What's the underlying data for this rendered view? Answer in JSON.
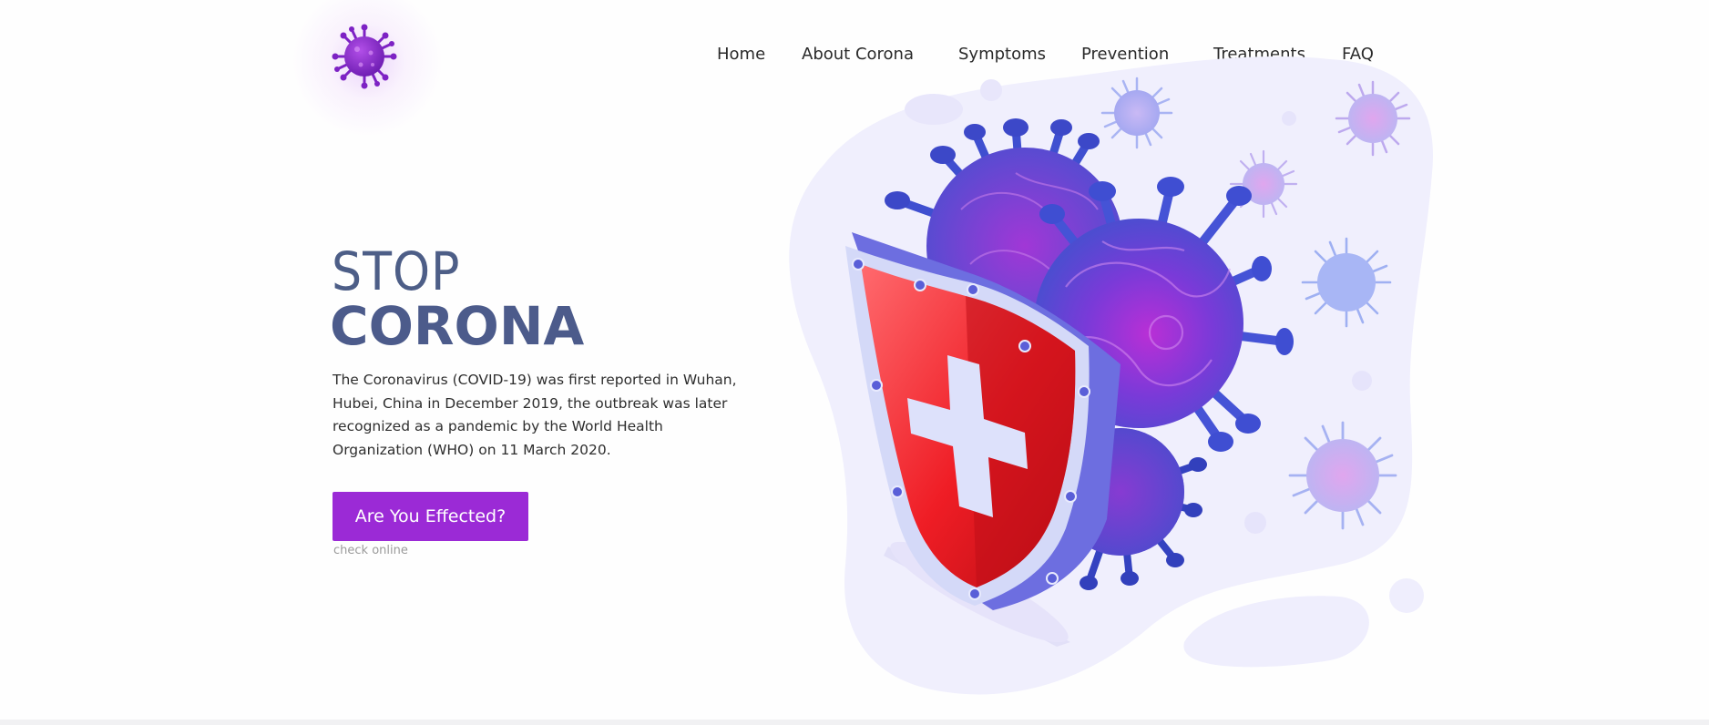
{
  "nav": {
    "items": [
      "Home",
      "About Corona",
      "Symptoms",
      "Prevention",
      "Treatments",
      "FAQ"
    ]
  },
  "hero": {
    "title_line1": "STOP",
    "title_line2": "CORONA",
    "description": "The Coronavirus (COVID-19) was first reported in Wuhan, Hubei, China in December 2019, the outbreak was later recognized as a pandemic by the World Health Organization (WHO) on 11 March 2020.",
    "cta_label": "Are You Effected?",
    "cta_sublabel": "check online"
  },
  "colors": {
    "accent": "#9b2ad6",
    "title": "#4c5b8b",
    "blob": "#f0effd",
    "virus_blue": "#4a55d6",
    "virus_purple": "#9a2cd8",
    "shield_red": "#e8232b",
    "shield_frame": "#7b7fe0"
  },
  "icons": {
    "logo": "coronavirus-logo-icon",
    "illustration": "virus-shield-illustration"
  }
}
